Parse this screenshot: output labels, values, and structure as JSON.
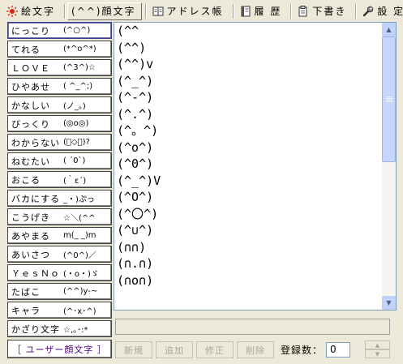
{
  "tabs": [
    {
      "label": "絵文字",
      "icon": "sun-icon"
    },
    {
      "label": "(^^)顔文字",
      "icon": "none"
    },
    {
      "label": "アドレス帳",
      "icon": "address-book-icon"
    },
    {
      "label": "履 歴",
      "icon": "history-icon"
    },
    {
      "label": "下書き",
      "icon": "draft-icon"
    },
    {
      "label": "設 定",
      "icon": "wrench-icon"
    }
  ],
  "categories": [
    {
      "name": "にっこり",
      "face": "(^○^)"
    },
    {
      "name": "てれる",
      "face": "(*^o^*)"
    },
    {
      "name": "ＬＯＶＥ",
      "face": "(^3^)☆"
    },
    {
      "name": "ひやあせ",
      "face": "( ^_^;)"
    },
    {
      "name": "かなしい",
      "face": "(ノ_。)"
    },
    {
      "name": "びっくり",
      "face": "(◎o◎)"
    },
    {
      "name": "わからない",
      "face": "(゚◇゚)?"
    },
    {
      "name": "ねむたい",
      "face": "( ´0`)"
    },
    {
      "name": "おこる",
      "face": "(｀ε´)"
    },
    {
      "name": "バカにする",
      "face": "_・)ぷっ"
    },
    {
      "name": "こうげき",
      "face": "☆＼(^^"
    },
    {
      "name": "あやまる",
      "face": "m(_ _)m"
    },
    {
      "name": "あいさつ",
      "face": "(^0^)／"
    },
    {
      "name": "ＹｅｓＮｏ",
      "face": "(・o・)ゞ"
    },
    {
      "name": "たばこ",
      "face": "(^^)y-~"
    },
    {
      "name": "キャラ",
      "face": "(^･x･^)"
    },
    {
      "name": "かざり文字",
      "face": "☆,｡･:*"
    }
  ],
  "user_button": "［ ユーザー顔文字 ］",
  "emoticons": [
    "(^^",
    "(^^)",
    "(^^)v",
    "(^_^)",
    "(^-^)",
    "(^.^)",
    "(^。^)",
    "(^o^)",
    "(^0^)",
    "(^_^)V",
    "(^O^)",
    "(^〇^)",
    "(^∪^)",
    "(∩∩)",
    "(∩.∩)",
    "(∩o∩)"
  ],
  "input": {
    "value": ""
  },
  "buttons": {
    "new": "新規",
    "add": "追加",
    "edit": "修正",
    "delete": "削除"
  },
  "count": {
    "label": "登録数：",
    "value": "0"
  },
  "colors": {
    "user_button_text": "#4b0082",
    "selected_border": "#3c3c8c",
    "sun_icon": "#e02010"
  }
}
